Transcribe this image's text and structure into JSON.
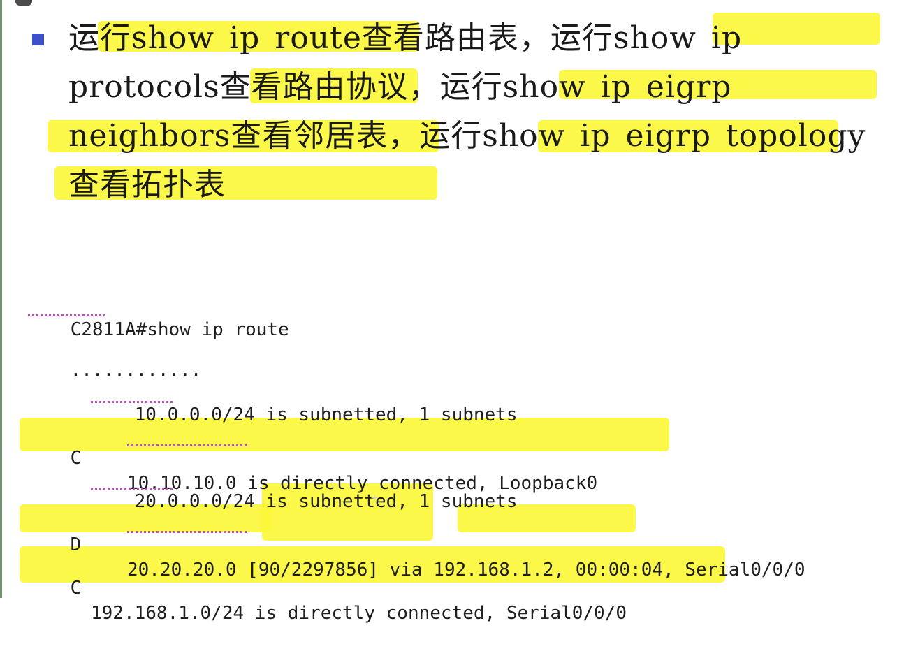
{
  "slide": {
    "bullet_text": "运行show ip route查看路由表，运行show ip protocols查看路由协议，运行show ip eigrp neighbors查看邻居表，运行show ip eigrp topology查看拓扑表"
  },
  "terminal": {
    "lines": [
      {
        "code": "",
        "text": "C2811A#show ip route"
      },
      {
        "code": "",
        "text": "............"
      },
      {
        "code": "",
        "text": "10.0.0.0/24 is subnetted, 1 subnets"
      },
      {
        "code": "C",
        "text": "10.10.10.0 is directly connected, Loopback0"
      },
      {
        "code": "",
        "text": "20.0.0.0/24 is subnetted, 1 subnets"
      },
      {
        "code": "D",
        "text": "20.20.20.0 [90/2297856] via 192.168.1.2, 00:00:04, Serial0/0/0"
      },
      {
        "code": "C",
        "text": "192.168.1.0/24 is directly connected, Serial0/0/0"
      }
    ]
  },
  "colors": {
    "highlight": "#fbf73a",
    "bullet": "#3b50c8",
    "spellcheck_underline": "#c04fc0"
  }
}
